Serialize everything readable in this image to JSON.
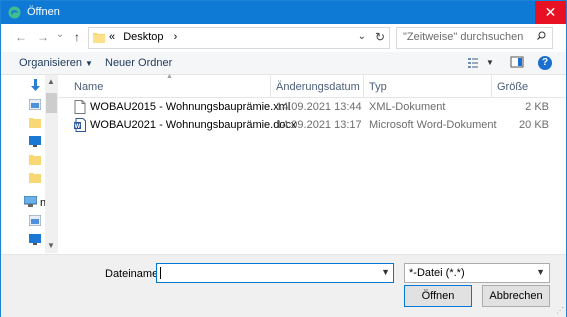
{
  "window": {
    "title": "Öffnen",
    "close_glyph": "✕"
  },
  "nav": {
    "back_glyph": "←",
    "forward_glyph": "→",
    "dropdown_glyph": "⌄",
    "up_glyph": "↑",
    "breadcrumb_prefix": "«",
    "breadcrumb": "Desktop",
    "breadcrumb_arrow": "›",
    "addr_dropdown": "⌄",
    "refresh_glyph": "↻",
    "search_placeholder": "\"Zeitweise\" durchsuchen"
  },
  "toolbar": {
    "organize_label": "Organisieren",
    "new_folder_label": "Neuer Ordner",
    "help": "?"
  },
  "left_pane": {
    "partial_label": "n"
  },
  "columns": {
    "name": "Name",
    "date": "Änderungsdatum",
    "type": "Typ",
    "size": "Größe"
  },
  "files": [
    {
      "name": "WOBAU2015 - Wohnungsbauprämie.xml",
      "date": "14.09.2021 13:44",
      "type": "XML-Dokument",
      "size": "2 KB",
      "icon": "document-icon"
    },
    {
      "name": "WOBAU2021 - Wohnungsbauprämie.docx",
      "date": "14.09.2021 13:17",
      "type": "Microsoft Word-Dokument",
      "size": "20 KB",
      "icon": "word-icon"
    }
  ],
  "footer": {
    "filename_label": "Dateiname:",
    "filename_value": "",
    "filetype_value": "*-Datei (*.*)",
    "open_label": "Öffnen",
    "cancel_label": "Abbrechen"
  },
  "colors": {
    "titlebar": "#0f7ad6",
    "close": "#e81123",
    "accent": "#0078d7"
  }
}
